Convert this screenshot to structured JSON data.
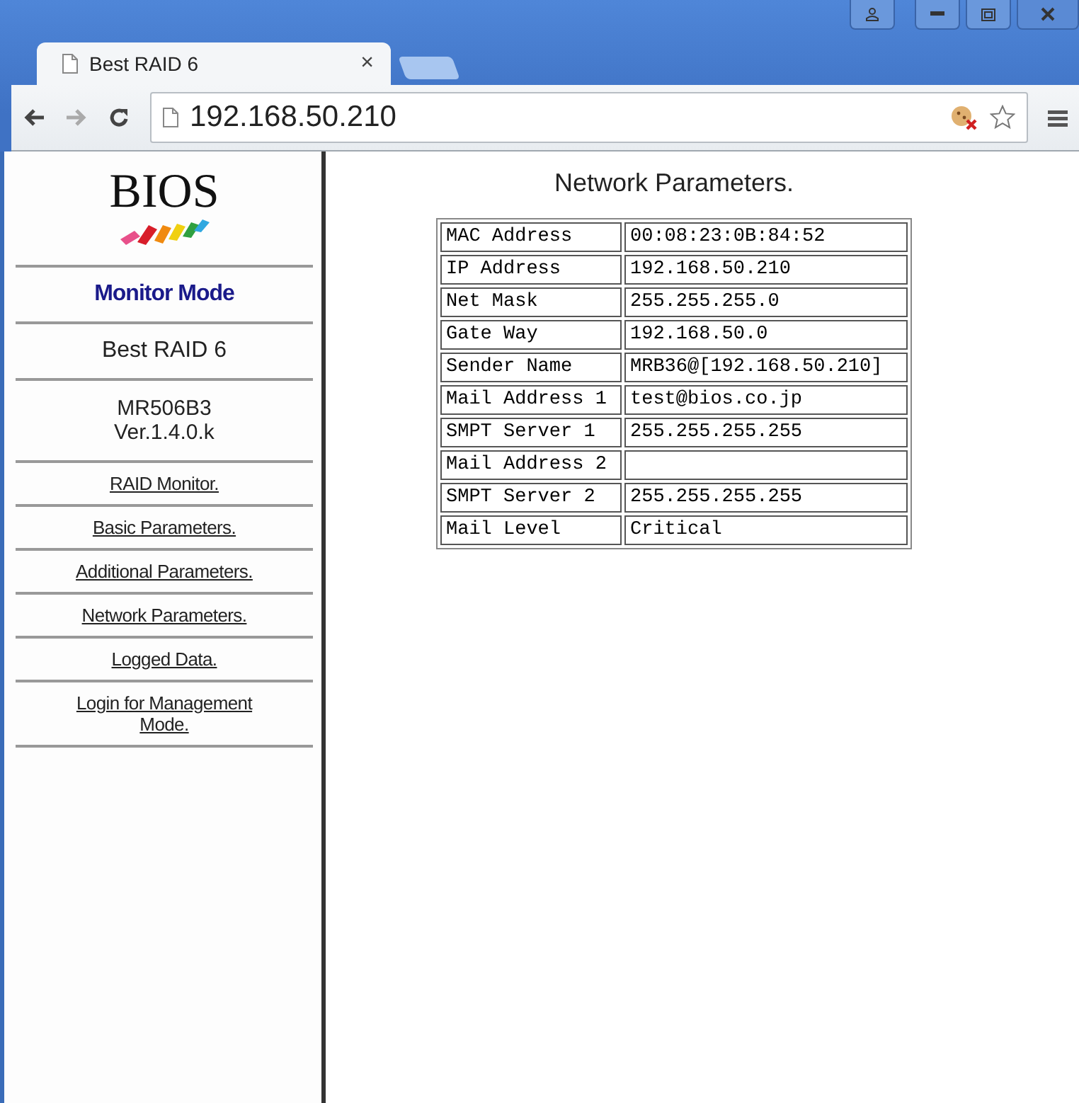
{
  "browser": {
    "tab_title": "Best RAID 6",
    "close_glyph": "×",
    "address": "192.168.50.210"
  },
  "sidebar": {
    "logo_text": "BIOS",
    "mode": "Monitor Mode",
    "product": "Best RAID 6",
    "model_lines": [
      "MR506B3",
      "Ver.1.4.0.k"
    ],
    "links": [
      {
        "label": "RAID Monitor."
      },
      {
        "label": "Basic Parameters."
      },
      {
        "label": "Additional Parameters."
      },
      {
        "label": "Network Parameters."
      },
      {
        "label": "Logged Data."
      },
      {
        "label": "Login for Management Mode."
      }
    ]
  },
  "main": {
    "title": "Network Parameters.",
    "rows": [
      {
        "label": "MAC Address",
        "value": "00:08:23:0B:84:52"
      },
      {
        "label": "IP Address",
        "value": "192.168.50.210"
      },
      {
        "label": "Net Mask",
        "value": "255.255.255.0"
      },
      {
        "label": "Gate Way",
        "value": "192.168.50.0"
      },
      {
        "label": "Sender Name",
        "value": "MRB36@[192.168.50.210]"
      },
      {
        "label": "Mail Address 1",
        "value": "test@bios.co.jp"
      },
      {
        "label": "SMPT Server 1",
        "value": "255.255.255.255"
      },
      {
        "label": "Mail Address 2"
      },
      {
        "label": "SMPT Server 2",
        "value": "255.255.255.255"
      },
      {
        "label": "Mail Level",
        "value": "Critical"
      }
    ]
  }
}
